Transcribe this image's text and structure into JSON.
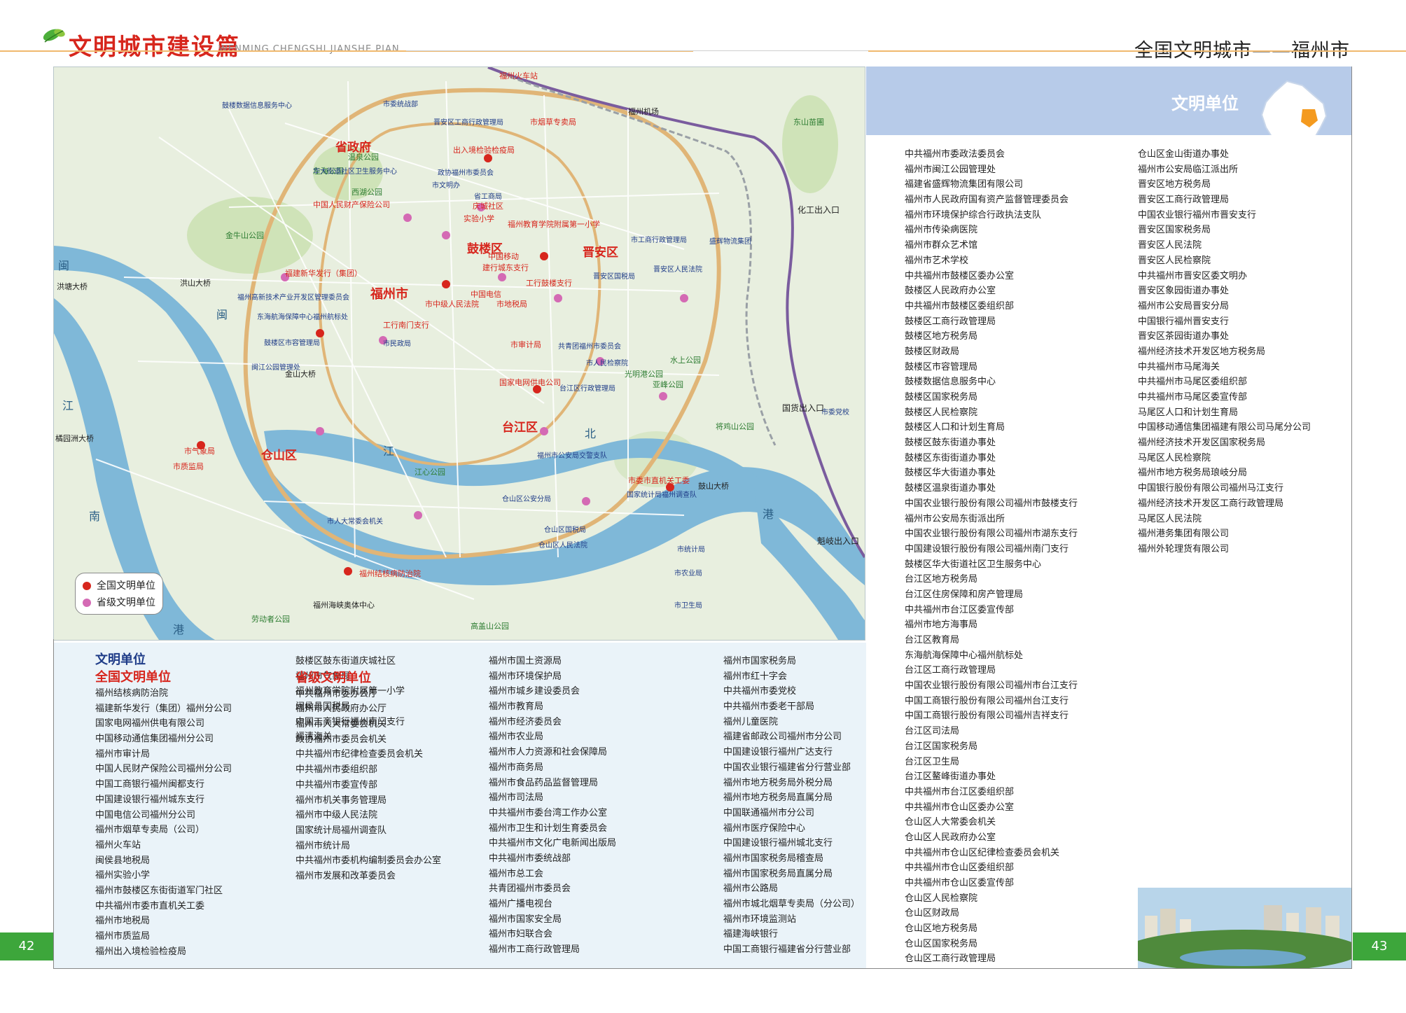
{
  "header": {
    "title": "文明城市建设篇",
    "subtitle": "WENMING CHENGSHI JIANSHE PIAN",
    "right_title": "全国文明城市——福州市"
  },
  "page_numbers": {
    "left": "42",
    "right": "43"
  },
  "colors": {
    "accent_green": "#3da63b",
    "title_red": "#d7261d",
    "band_blue": "#b7cbe9",
    "water": "#7fb8d8",
    "ring_road": "#e0b577"
  },
  "map": {
    "districts": [
      "省政府",
      "福州市",
      "鼓楼区",
      "晋安区",
      "台江区",
      "仓山区"
    ],
    "water_labels": [
      "闽",
      "江",
      "南",
      "港",
      "闽",
      "江",
      "北",
      "港"
    ],
    "bridges": [
      "洪塘大桥",
      "洪山大桥",
      "金山大桥",
      "橘园洲大桥",
      "鼓山大桥",
      "福州机场"
    ],
    "parks": [
      "金牛山公园",
      "西湖公园",
      "温泉公园",
      "左海公园",
      "东山苗圃",
      "光明港公园",
      "亚峰公园",
      "水上公园",
      "将鸡山公园",
      "江心公园",
      "劳动者公园",
      "高盖山公园",
      "福州海峡奥体中心"
    ],
    "entrances": [
      "化工出入口",
      "国货出入口",
      "魁岐出入口"
    ],
    "full_names": [
      "福州火车站",
      "市烟草专卖局",
      "出入境检验检疫局",
      "中国人民财产保险公司",
      "实验小学",
      "庆城社区",
      "福州教育学院附属第一小学",
      "福建新华发行（集团）",
      "中国移动",
      "建行城东支行",
      "市中级人民法院",
      "中国电信",
      "市地税局",
      "工行南门支行",
      "工行鼓楼支行",
      "市审计局",
      "国家电网供电公司",
      "市气象局",
      "市质监局",
      "市委市直机关工委",
      "福州结核病防治院"
    ],
    "labels": [
      "市委统战部",
      "鼓楼数据信息服务中心",
      "华大街道社区卫生服务中心",
      "晋安区工商行政管理局",
      "市文明办",
      "政协福州市委员会",
      "省工商局",
      "市工商行政管理局",
      "福州高新技术产业开发区管理委员会",
      "东海航海保障中心福州航标处",
      "鼓楼区市容管理局",
      "闽江公园管理处",
      "晋安区人民法院",
      "盛辉物流集团",
      "晋安区国税局",
      "市人民检察院",
      "台江区行政管理局",
      "市委党校",
      "共青团福州市委员会",
      "市人大常委会机关",
      "市民政局",
      "福州市公安局交警支队",
      "国家统计局福州调查队",
      "仓山区公安分局",
      "仓山区国税局",
      "仓山区人民法院",
      "市统计局",
      "市卫生局",
      "市农业局"
    ],
    "legend": [
      {
        "label": "全国文明单位",
        "color": "#d7261d"
      },
      {
        "label": "省级文明单位",
        "color": "#d46ab4"
      }
    ]
  },
  "right_panel": {
    "title": "文明单位",
    "col1": [
      "中共福州市委政法委员会",
      "福州市闽江公园管理处",
      "福建省盛辉物流集团有限公司",
      "福州市人民政府国有资产监督管理委员会",
      "福州市环境保护综合行政执法支队",
      "福州市传染病医院",
      "福州市群众艺术馆",
      "福州市艺术学校",
      "中共福州市鼓楼区委办公室",
      "鼓楼区人民政府办公室",
      "中共福州市鼓楼区委组织部",
      "鼓楼区工商行政管理局",
      "鼓楼区地方税务局",
      "鼓楼区财政局",
      "鼓楼区市容管理局",
      "鼓楼数据信息服务中心",
      "鼓楼区国家税务局",
      "鼓楼区人民检察院",
      "鼓楼区人口和计划生育局",
      "鼓楼区鼓东街道办事处",
      "鼓楼区东街街道办事处",
      "鼓楼区华大街道办事处",
      "鼓楼区温泉街道办事处",
      "中国农业银行股份有限公司福州市鼓楼支行",
      "福州市公安局东街派出所",
      "中国农业银行股份有限公司福州市湖东支行",
      "中国建设银行股份有限公司福州南门支行",
      "鼓楼区华大街道社区卫生服务中心",
      "台江区地方税务局",
      "台江区住房保障和房产管理局",
      "中共福州市台江区委宣传部",
      "福州市地方海事局",
      "台江区教育局",
      "东海航海保障中心福州航标处",
      "台江区工商行政管理局",
      "中国农业银行股份有限公司福州市台江支行",
      "中国工商银行股份有限公司福州台江支行",
      "中国工商银行股份有限公司福州吉祥支行",
      "台江区司法局",
      "台江区国家税务局",
      "台江区卫生局",
      "台江区鳌峰街道办事处",
      "中共福州市台江区委组织部",
      "中共福州市仓山区委办公室",
      "仓山区人大常委会机关",
      "仓山区人民政府办公室",
      "中共福州市仓山区纪律检查委员会机关",
      "中共福州市仓山区委组织部",
      "中共福州市仓山区委宣传部",
      "仓山区人民检察院",
      "仓山区财政局",
      "仓山区地方税务局",
      "仓山区国家税务局",
      "仓山区工商行政管理局"
    ],
    "col2": [
      "仓山区金山街道办事处",
      "福州市公安局临江派出所",
      "晋安区地方税务局",
      "晋安区工商行政管理局",
      "中国农业银行福州市晋安支行",
      "晋安区国家税务局",
      "晋安区人民法院",
      "晋安区人民检察院",
      "中共福州市晋安区委文明办",
      "晋安区象园街道办事处",
      "福州市公安局晋安分局",
      "中国银行福州晋安支行",
      "晋安区茶园街道办事处",
      "福州经济技术开发区地方税务局",
      "中共福州市马尾海关",
      "中共福州市马尾区委组织部",
      "中共福州市马尾区委宣传部",
      "马尾区人口和计划生育局",
      "中国移动通信集团福建有限公司马尾分公司",
      "福州经济技术开发区国家税务局",
      "马尾区人民检察院",
      "福州市地方税务局琅岐分局",
      "中国银行股份有限公司福州马江支行",
      "福州经济技术开发区工商行政管理局",
      "马尾区人民法院",
      "福州港务集团有限公司",
      "福州外轮理货有限公司"
    ]
  },
  "bottom_list": {
    "heading": "文明单位",
    "national_heading": "全国文明单位",
    "provincial_heading": "省级文明单位",
    "col1": [
      "福州结核病防治院",
      "福建新华发行（集团）福州分公司",
      "国家电网福州供电有限公司",
      "中国移动通信集团福州分公司",
      "福州市审计局",
      "中国人民财产保险公司福州分公司",
      "中国工商银行福州闽都支行",
      "中国建设银行福州城东支行",
      "中国电信公司福州分公司",
      "福州市烟草专卖局（公司）",
      "福州火车站",
      "闽侯县地税局",
      "福州实验小学",
      "福州市鼓楼区东街街道军门社区",
      "中共福州市委市直机关工委",
      "福州市地税局",
      "福州市质监局",
      "福州出入境检验检疫局"
    ],
    "col2a": [
      "鼓楼区鼓东街道庆城社区",
      "福州市气象局",
      "福州教育学院附属第一小学",
      "闽侯县国税局",
      "中国工商银行福州南门支行",
      "福清海关"
    ],
    "col2b": [
      "中共福州市委办公厅",
      "福州市人民政府办公厅",
      "福州市人大常委会机关",
      "政协福州市委员会机关",
      "中共福州市纪律检查委员会机关",
      "中共福州市委组织部",
      "中共福州市委宣传部",
      "福州市机关事务管理局",
      "福州市中级人民法院",
      "国家统计局福州调查队",
      "福州市统计局",
      "中共福州市委机构编制委员会办公室",
      "福州市发展和改革委员会"
    ],
    "col3": [
      "福州市国土资源局",
      "福州市环境保护局",
      "福州市城乡建设委员会",
      "福州市教育局",
      "福州市经济委员会",
      "福州市农业局",
      "福州市人力资源和社会保障局",
      "福州市商务局",
      "福州市食品药品监督管理局",
      "福州市司法局",
      "中共福州市委台湾工作办公室",
      "福州市卫生和计划生育委员会",
      "中共福州市文化广电新闻出版局",
      "中共福州市委统战部",
      "福州市总工会",
      "共青团福州市委员会",
      "福州广播电视台",
      "福州市国家安全局",
      "福州市妇联合会",
      "福州市工商行政管理局"
    ],
    "col4": [
      "福州市国家税务局",
      "福州市红十字会",
      "中共福州市委党校",
      "中共福州市委老干部局",
      "福州儿童医院",
      "福建省邮政公司福州市分公司",
      "中国建设银行福州广达支行",
      "中国农业银行福建省分行营业部",
      "福州市地方税务局外税分局",
      "福州市地方税务局直属分局",
      "中国联通福州市分公司",
      "福州市医疗保险中心",
      "中国建设银行福州城北支行",
      "福州市国家税务局稽查局",
      "福州市国家税务局直属分局",
      "福州市公路局",
      "福州市城北烟草专卖局（分公司）",
      "福州市环境监测站",
      "福建海峡银行",
      "中国工商银行福建省分行营业部"
    ]
  }
}
